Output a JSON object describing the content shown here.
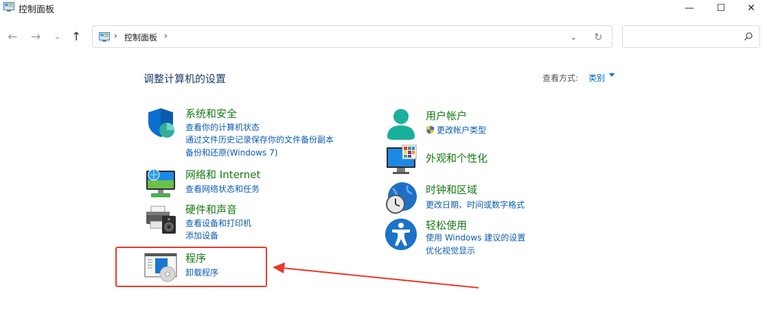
{
  "window": {
    "title": "控制面板",
    "minimize": "—",
    "maximize": "☐",
    "close": "✕"
  },
  "nav": {
    "back": "←",
    "forward": "→",
    "recent": "⌄",
    "up": "↑",
    "separator": "›",
    "breadcrumb": "控制面板",
    "dropdown": "⌄",
    "refresh": "↻"
  },
  "search": {
    "placeholder": ""
  },
  "header": {
    "title": "调整计算机的设置",
    "view_by_label": "查看方式:",
    "view_by_value": "类别"
  },
  "categories": [
    {
      "title": "系统和安全",
      "links": [
        "查看你的计算机状态",
        "通过文件历史记录保存你的文件备份副本",
        "备份和还原(Windows 7)"
      ]
    },
    {
      "title": "网络和 Internet",
      "links": [
        "查看网络状态和任务"
      ]
    },
    {
      "title": "硬件和声音",
      "links": [
        "查看设备和打印机",
        "添加设备"
      ]
    },
    {
      "title": "程序",
      "links": [
        "卸载程序"
      ]
    },
    {
      "title": "用户帐户",
      "links": [
        "更改帐户类型"
      ]
    },
    {
      "title": "外观和个性化",
      "links": []
    },
    {
      "title": "时钟和区域",
      "links": [
        "更改日期、时间或数字格式"
      ]
    },
    {
      "title": "轻松使用",
      "links": [
        "使用 Windows 建议的设置",
        "优化视觉显示"
      ]
    }
  ],
  "colors": {
    "category_title": "#137a13",
    "link": "#0b5bb5",
    "heading": "#1e3c6e",
    "annotation": "#e8392a"
  }
}
